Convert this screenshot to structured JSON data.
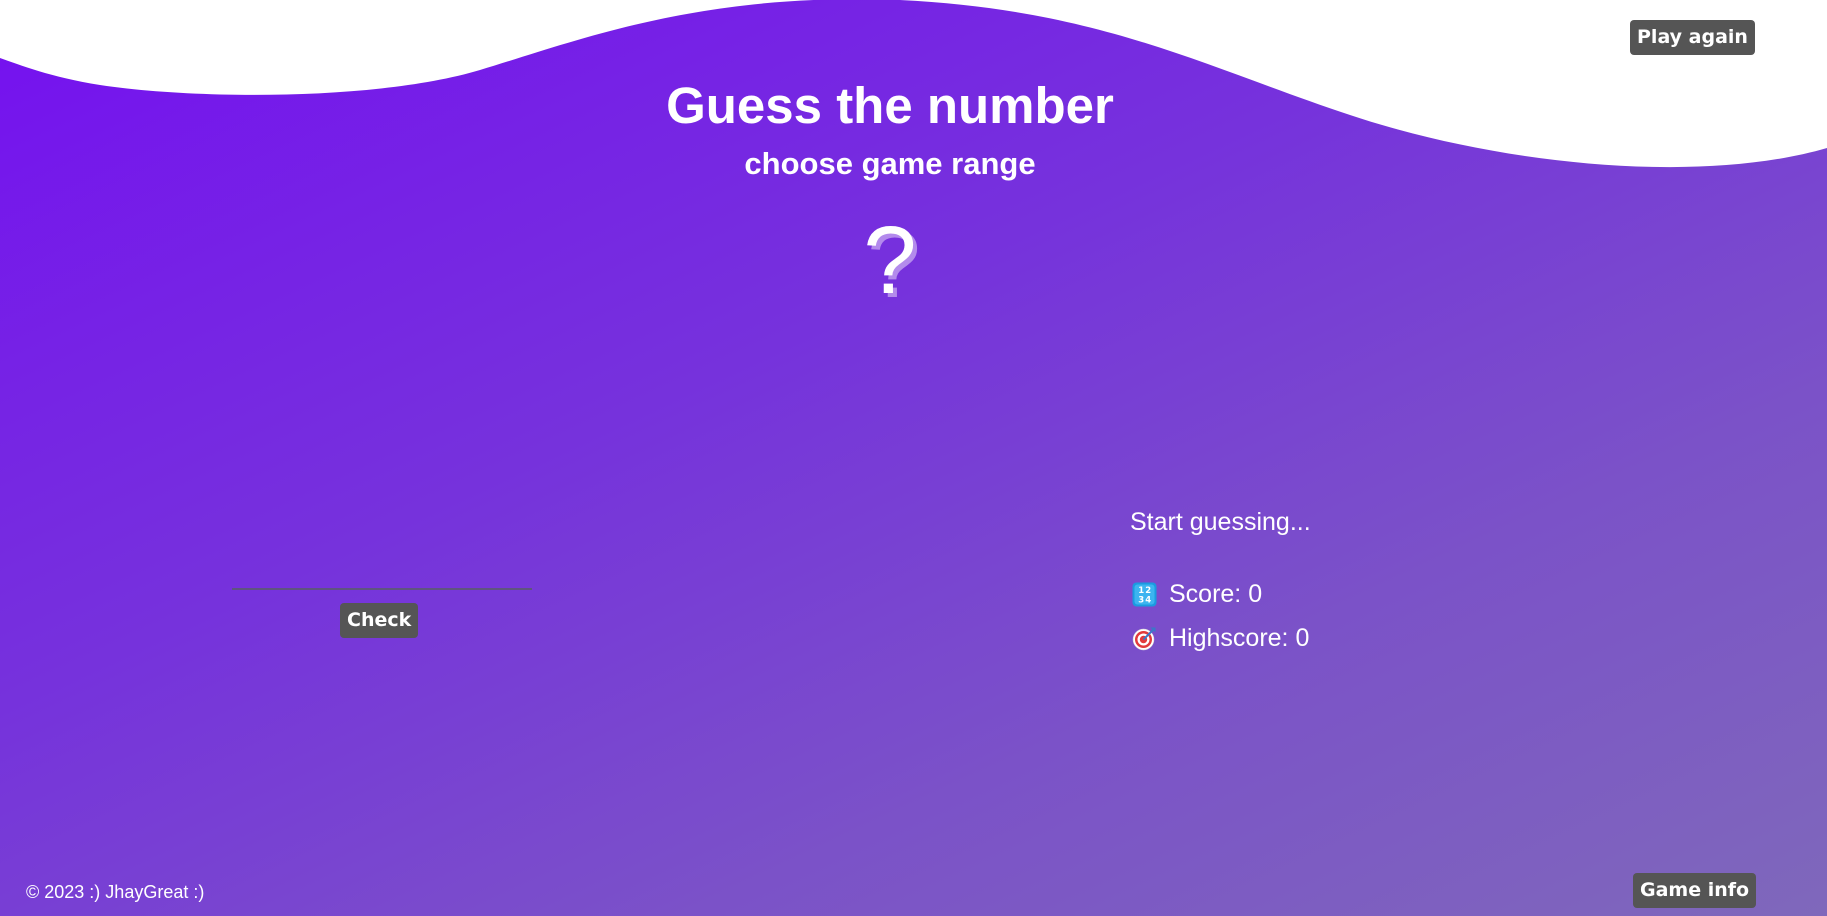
{
  "header": {
    "play_again_label": "Play again",
    "title": "Guess the number",
    "subtitle": "choose game range",
    "secret_number": "?"
  },
  "guess": {
    "input_value": "",
    "check_label": "Check"
  },
  "status": {
    "message": "Start guessing...",
    "score_label": "Score: 0",
    "highscore_label": "Highscore: 0"
  },
  "footer": {
    "copyright": "© 2023 :) JhayGreat :)",
    "game_info_label": "Game info"
  },
  "icons": {
    "score": "input-numbers-icon",
    "highscore": "direct-hit-icon"
  },
  "colors": {
    "gradient_start": "#7510f0",
    "gradient_end": "#7f68bb",
    "button_bg": "#555555",
    "text": "#ffffff"
  }
}
